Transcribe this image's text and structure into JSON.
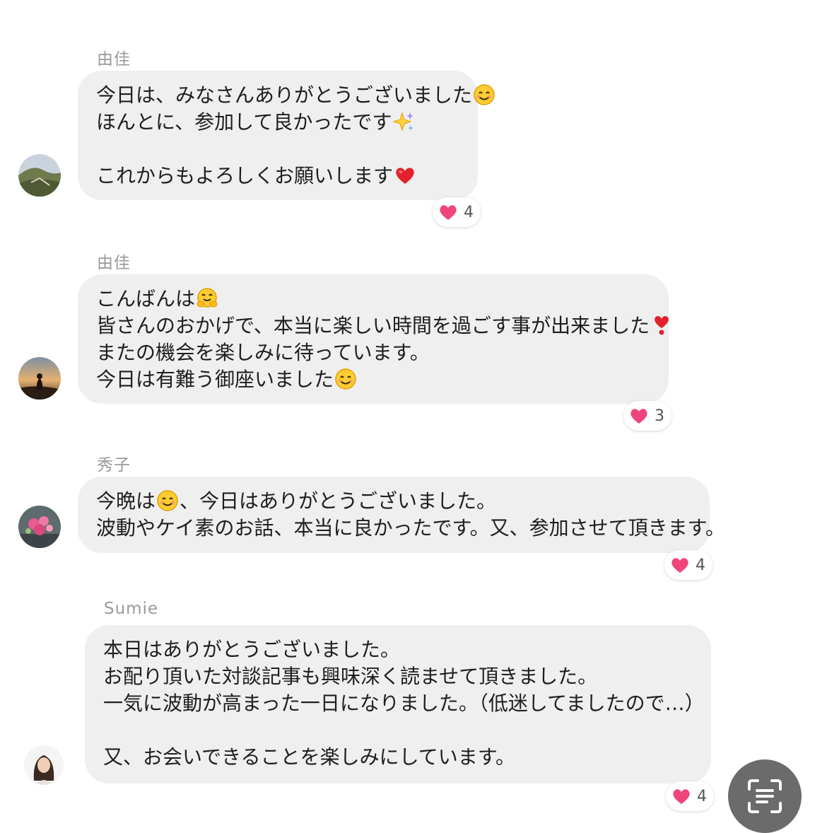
{
  "messages": [
    {
      "sender": "由佳",
      "avatar": "mountain-landscape-avatar",
      "lines": [
        {
          "text": "今日は、みなさんありがとうございました",
          "emoji": "smiling-face-icon"
        },
        {
          "text": "ほんとに、参加して良かったです",
          "emoji": "sparkles-icon"
        },
        {
          "text": "",
          "emoji": ""
        },
        {
          "text": "これからもよろしくお願いします",
          "emoji": "red-heart-icon"
        }
      ],
      "reaction": {
        "icon": "pink-heart-icon",
        "count": "4"
      }
    },
    {
      "sender": "由佳",
      "avatar": "sunset-silhouette-avatar",
      "lines": [
        {
          "text": "こんばんは",
          "emoji": "hugging-face-icon"
        },
        {
          "text": "皆さんのおかげで、本当に楽しい時間を過ごす事が出来ました",
          "emoji": "heart-exclamation-icon"
        },
        {
          "text": "またの機会を楽しみに待っています。",
          "emoji": ""
        },
        {
          "text": "今日は有難う御座いました",
          "emoji": "smiling-face-icon"
        }
      ],
      "reaction": {
        "icon": "pink-heart-icon",
        "count": "3"
      }
    },
    {
      "sender": "秀子",
      "avatar": "pink-flowers-avatar",
      "lines": [
        {
          "text_before": "今晩は",
          "emoji": "smiling-face-icon",
          "text": "、今日はありがとうございました。"
        },
        {
          "text": "波動やケイ素のお話、本当に良かったです。又、参加させて頂きます。",
          "emoji": ""
        }
      ],
      "reaction": {
        "icon": "pink-heart-icon",
        "count": "4"
      }
    },
    {
      "sender": "Sumie",
      "avatar": "woman-portrait-avatar",
      "lines": [
        {
          "text": "本日はありがとうございました。",
          "emoji": ""
        },
        {
          "text": "お配り頂いた対談記事も興味深く読ませて頂きました。",
          "emoji": ""
        },
        {
          "text": "一気に波動が高まった一日になりました。（低迷してましたので…）",
          "emoji": ""
        },
        {
          "text": "",
          "emoji": ""
        },
        {
          "text": "又、お会いできることを楽しみにしています。",
          "emoji": ""
        }
      ],
      "reaction": {
        "icon": "pink-heart-icon",
        "count": "4"
      }
    }
  ],
  "floating_button": {
    "icon": "scan-text-icon"
  },
  "colors": {
    "bubble": "#efefef",
    "sender": "#9a9a9a",
    "heart": "#f0457a",
    "button": "#6b6b6b"
  }
}
